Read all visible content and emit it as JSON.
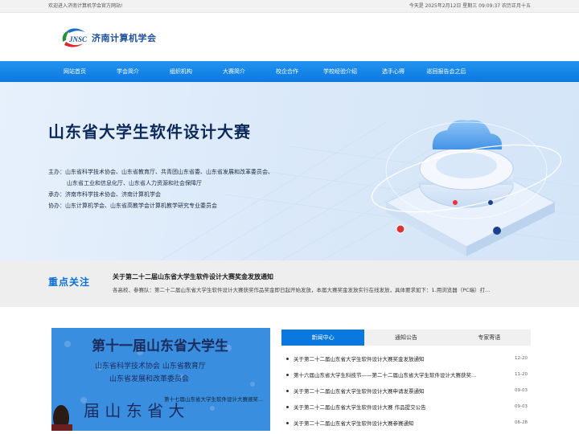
{
  "topbar": {
    "welcome": "欢迎进入济南计算机学会官方网站!",
    "date": "今天是 2025年2月12日 星期三 09:09:37 农历正月十五"
  },
  "logo": {
    "mark_text": "JNSC",
    "name": "济南计算机学会"
  },
  "nav": {
    "items": [
      {
        "label": "网站首页"
      },
      {
        "label": "学会简介"
      },
      {
        "label": "组织机构"
      },
      {
        "label": "大赛简介"
      },
      {
        "label": "校企合作"
      },
      {
        "label": "学校经验介绍"
      },
      {
        "label": "选手心得"
      },
      {
        "label": "巡回报告会之后"
      }
    ]
  },
  "hero": {
    "title": "山东省大学生软件设计大赛",
    "organizers_1": "主办：山东省科学技术协会、山东省教育厅、共青团山东省委、山东省发展和改革委员会、",
    "organizers_2": "山东省工业和信息化厅、山东省人力资源和社会保障厅",
    "undertaker": "承办：济南市科学技术协会、济南计算机学会",
    "coorganizer": "协办：山东计算机学会、山东省高教学会计算机教学研究专业委员会"
  },
  "focus": {
    "label": "重点关注",
    "title": "关于第二十二届山东省大学生软件设计大赛奖金发放通知",
    "desc": "各高校、参赛队：第二十二届山东省大学生软件设计大赛获奖作品奖金即日起开始发放，本届大赛奖金发放实行在线发放，具体要求如下：1.用浏览器（PC端）打..."
  },
  "photo": {
    "caption": "第十七届山东省大学生软件设计大赛颁奖...",
    "banner_line1": "第十一届山东省大学生",
    "banner_line2": "山东省科学技术协会  山东省教育厅",
    "banner_line3": "山东省发展和改革委员会",
    "banner_line4": "届  山  东  省  大"
  },
  "tabs": [
    {
      "label": "新闻中心"
    },
    {
      "label": "通知公告"
    },
    {
      "label": "专家寄语"
    }
  ],
  "news": [
    {
      "title": "关于第二十二届山东省大学生软件设计大赛奖金发放通知",
      "date": "12-20"
    },
    {
      "title": "第十六届山东省大学生科技节——第二十二届山东省大学生软件设计大赛获奖...",
      "date": "11-20"
    },
    {
      "title": "关于第二十二届山东省大学生软件设计大赛申请发票通知",
      "date": "09-03"
    },
    {
      "title": "关于第二十二届山东省大学生软件设计大赛 作品提交公告",
      "date": "09-03"
    },
    {
      "title": "关于第二十二届山东省大学生软件设计大赛参赛通知",
      "date": "06-28"
    }
  ],
  "colors": {
    "brand_blue": "#0b78e0",
    "title_navy": "#0d2a5a",
    "focus_blue": "#0b6fd6"
  }
}
